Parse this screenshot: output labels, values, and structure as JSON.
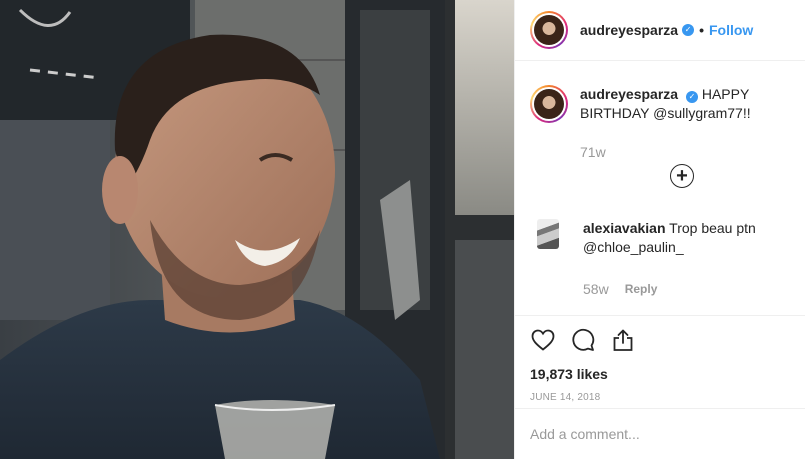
{
  "post": {
    "username": "audreyesparza",
    "follow_label": "Follow",
    "separator": "•",
    "verified_mark": "✓"
  },
  "caption": {
    "username": "audreyesparza",
    "text": "HAPPY BIRTHDAY",
    "mention": "@sullygram77!!",
    "time": "71w"
  },
  "load_more_icon": "plus-circle-icon",
  "comment": {
    "username": "alexiavakian",
    "text": "Trop beau ptn",
    "mention": "@chloe_paulin_",
    "time": "58w",
    "reply_label": "Reply"
  },
  "actions": {
    "icons": [
      "heart-icon",
      "comment-icon",
      "share-icon"
    ],
    "likes": "19,873 likes",
    "date": "JUNE 14, 2018"
  },
  "add_comment": {
    "placeholder": "Add a comment..."
  },
  "colors": {
    "link_blue": "#3897f0",
    "muted": "#999999",
    "border": "#efefef",
    "text": "#262626"
  }
}
